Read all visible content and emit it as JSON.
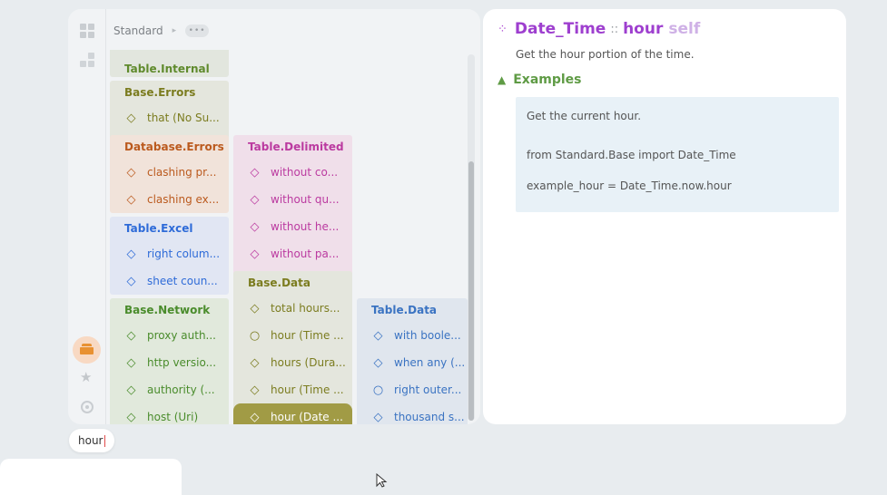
{
  "breadcrumb": {
    "root": "Standard",
    "arrow": "▸",
    "more": "•••"
  },
  "cards": [
    {
      "title": "Table.Internal",
      "title_color": "#5f8a2c",
      "bg": "#e2e6de",
      "items": []
    },
    {
      "title": "Base.Errors",
      "title_color": "#7b7c1f",
      "bg": "#e4e6dd",
      "items": [
        {
          "icon": "◇",
          "text": "that (No Su..."
        }
      ]
    },
    {
      "title": "Database.Errors",
      "title_color": "#bb5a1e",
      "bg": "#f1e3da",
      "items": [
        {
          "icon": "◇",
          "text": "clashing pr..."
        },
        {
          "icon": "◇",
          "text": "clashing ex..."
        }
      ]
    },
    {
      "title": "Table.Excel",
      "title_color": "#2e6bd8",
      "bg": "#e1e6f3",
      "items": [
        {
          "icon": "◇",
          "text": "right colum..."
        },
        {
          "icon": "◇",
          "text": "sheet coun..."
        }
      ]
    },
    {
      "title": "Base.Network",
      "title_color": "#4a8c2c",
      "bg": "#e1e9dc",
      "items": [
        {
          "icon": "◇",
          "text": "proxy auth..."
        },
        {
          "icon": "◇",
          "text": "http versio..."
        },
        {
          "icon": "◇",
          "text": "authority (..."
        },
        {
          "icon": "◇",
          "text": "host (Uri)"
        }
      ]
    },
    {
      "title": "Table.Delimited",
      "title_color": "#bb3aa0",
      "bg": "#f0dfea",
      "items": [
        {
          "icon": "◇",
          "text": "without co..."
        },
        {
          "icon": "◇",
          "text": "without qu..."
        },
        {
          "icon": "◇",
          "text": "without he..."
        },
        {
          "icon": "◇",
          "text": "without pa..."
        }
      ]
    },
    {
      "title": "Base.Data",
      "title_color": "#7b7c1f",
      "bg": "#e4e6dd",
      "items": [
        {
          "icon": "◇",
          "text": "total hours..."
        },
        {
          "icon": "○",
          "text": "hour (Time ..."
        },
        {
          "icon": "◇",
          "text": "hours (Dura..."
        },
        {
          "icon": "◇",
          "text": "hour (Time ..."
        },
        {
          "icon": "◇",
          "text": "hour (Date ..."
        }
      ]
    },
    {
      "title": "Table.Data",
      "title_color": "#3a73c2",
      "bg": "#e0e6ee",
      "items": [
        {
          "icon": "◇",
          "text": "with boole..."
        },
        {
          "icon": "◇",
          "text": "when any (..."
        },
        {
          "icon": "○",
          "text": "right outer..."
        },
        {
          "icon": "◇",
          "text": "thousand s..."
        }
      ]
    }
  ],
  "doc": {
    "type_name": "Date_Time",
    "separator": "::",
    "method": "hour",
    "self_label": "self",
    "description": "Get the hour portion of the time.",
    "examples_label": "Examples",
    "example_lines": [
      "Get the current hour.",
      "from Standard.Base import Date_Time",
      "example_hour = Date_Time.now.hour"
    ]
  },
  "search": {
    "value": "hour"
  },
  "colors": {
    "accent_selected": "#a19b45",
    "doc_accent": "#9e3fcf",
    "examples_green": "#5f9b45"
  }
}
